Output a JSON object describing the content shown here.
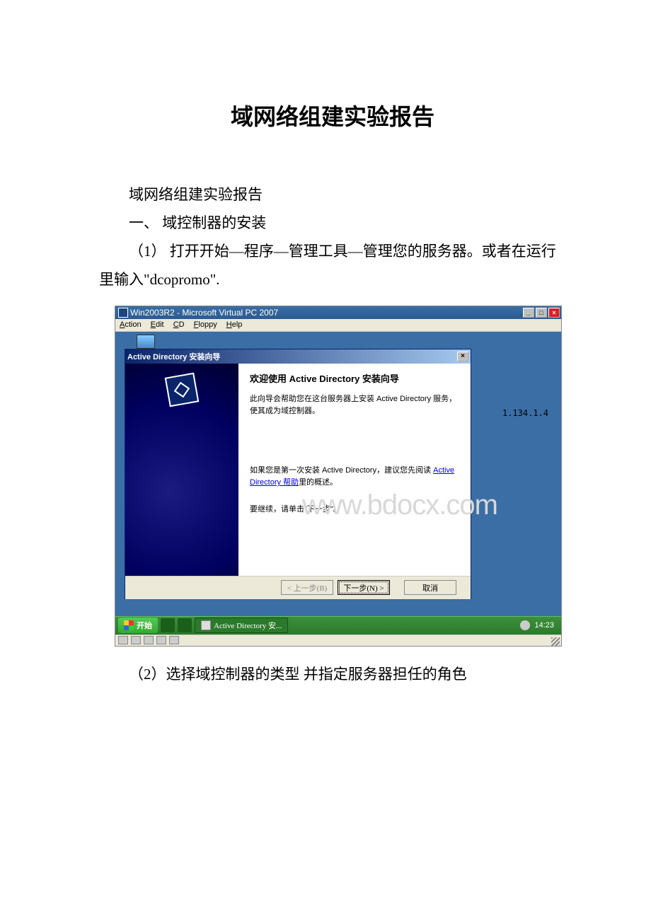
{
  "doc": {
    "title": "域网络组建实验报告",
    "line1": "域网络组建实验报告",
    "line2": "一、 域控制器的安装",
    "line3": "（1） 打开开始—程序—管理工具—管理您的服务器。或者在运行里输入\"dcopromo\".",
    "line4": "（2）选择域控制器的类型 并指定服务器担任的角色"
  },
  "vm": {
    "title": "Win2003R2 - Microsoft Virtual PC 2007",
    "menu": {
      "action": "Action",
      "edit": "Edit",
      "cd": "CD",
      "floppy": "Floppy",
      "help": "Help"
    },
    "ip": "1.134.1.4"
  },
  "wizard": {
    "title": "Active Directory 安装向导",
    "heading": "欢迎使用 Active Directory 安装向导",
    "desc": "此向导会帮助您在这台服务器上安装 Active Directory 服务，使其成为域控制器。",
    "hint1_pre": "如果您是第一次安装 Active Directory，建议您先阅读 ",
    "hint1_link": "Active Directory 帮助",
    "hint1_post": "里的概述。",
    "hint2": "要继续，请单击\"下一步\"。",
    "btnBack": "< 上一步(B)",
    "btnNext": "下一步(N) >",
    "btnCancel": "取消"
  },
  "watermark": "www.bdocx.com",
  "taskbar": {
    "start": "开始",
    "taskitem": "Active Directory 安...",
    "clock": "14:23"
  }
}
